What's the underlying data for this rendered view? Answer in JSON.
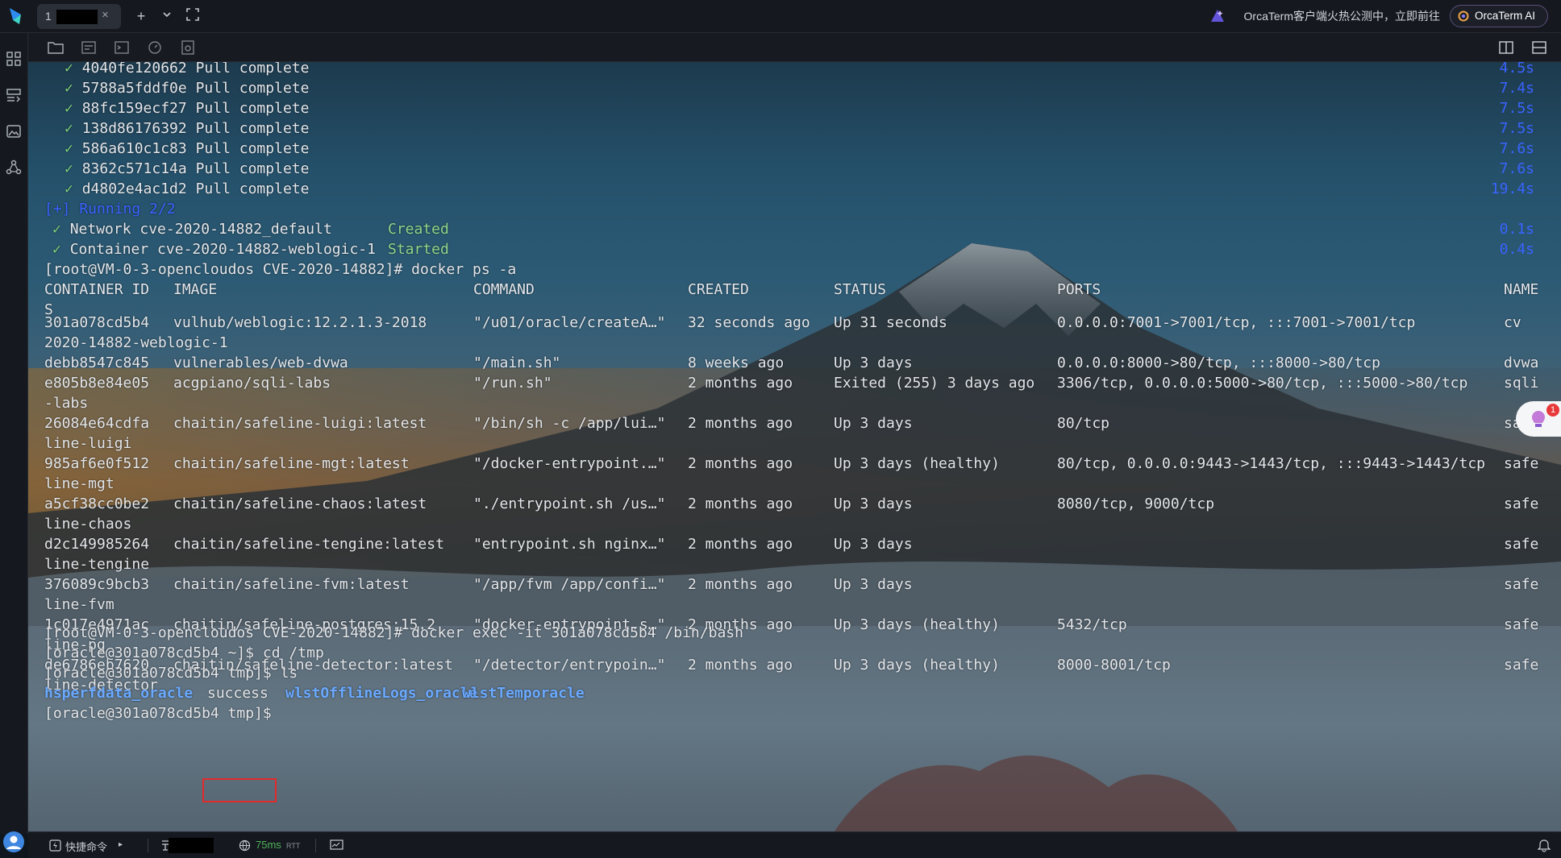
{
  "tabs": [
    {
      "label": "1",
      "close": "×"
    }
  ],
  "topbar": {
    "add": "+",
    "dropdown": "⌄",
    "fullscreen": "⛶",
    "promo": "OrcaTerm客户端火热公测中，立即前往",
    "ai_button": "OrcaTerm AI"
  },
  "terminal": {
    "pull_lines": [
      {
        "mark": "✓",
        "id": "4040fe120662",
        "status": "Pull complete",
        "time": "4.5s"
      },
      {
        "mark": "✓",
        "id": "5788a5fddf0e",
        "status": "Pull complete",
        "time": "7.4s"
      },
      {
        "mark": "✓",
        "id": "88fc159ecf27",
        "status": "Pull complete",
        "time": "7.5s"
      },
      {
        "mark": "✓",
        "id": "138d86176392",
        "status": "Pull complete",
        "time": "7.5s"
      },
      {
        "mark": "✓",
        "id": "586a610c1c83",
        "status": "Pull complete",
        "time": "7.6s"
      },
      {
        "mark": "✓",
        "id": "8362c571c14a",
        "status": "Pull complete",
        "time": "7.6s"
      },
      {
        "mark": "✓",
        "id": "d4802e4ac1d2",
        "status": "Pull complete",
        "time": "19.4s"
      }
    ],
    "running": "[+] Running 2/2",
    "network": {
      "mark": "✓",
      "text": "Network cve-2020-14882_default",
      "state": "Created",
      "time": "0.1s"
    },
    "container": {
      "mark": "✓",
      "text": "Container cve-2020-14882-weblogic-1",
      "state": "Started",
      "time": "0.4s"
    },
    "cmd_ps": "[root@VM-0-3-opencloudos CVE-2020-14882]# docker ps -a",
    "headers": {
      "id": "CONTAINER ID",
      "image": "IMAGE",
      "command": "COMMAND",
      "created": "CREATED",
      "status": "STATUS",
      "ports": "PORTS",
      "names": "NAME",
      "names_wrap": "S"
    },
    "rows": [
      {
        "id": "301a078cd5b4",
        "image": "vulhub/weblogic:12.2.1.3-2018",
        "command": "\"/u01/oracle/createA…\"",
        "created": "32 seconds ago",
        "status": "Up 31 seconds",
        "ports": "0.0.0.0:7001->7001/tcp, :::7001->7001/tcp",
        "names": "cv",
        "wrap": "2020-14882-weblogic-1"
      },
      {
        "id": "debb8547c845",
        "image": "vulnerables/web-dvwa",
        "command": "\"/main.sh\"",
        "created": "8 weeks ago",
        "status": "Up 3 days",
        "ports": "0.0.0.0:8000->80/tcp, :::8000->80/tcp",
        "names": "dvwa",
        "wrap": ""
      },
      {
        "id": "e805b8e84e05",
        "image": "acgpiano/sqli-labs",
        "command": "\"/run.sh\"",
        "created": "2 months ago",
        "status": "Exited (255) 3 days ago",
        "ports": "3306/tcp, 0.0.0.0:5000->80/tcp, :::5000->80/tcp",
        "names": "sqli",
        "wrap": "-labs"
      },
      {
        "id": "26084e64cdfa",
        "image": "chaitin/safeline-luigi:latest",
        "command": "\"/bin/sh -c /app/lui…\"",
        "created": "2 months ago",
        "status": "Up 3 days",
        "ports": "80/tcp",
        "names": "safe",
        "wrap": "line-luigi"
      },
      {
        "id": "985af6e0f512",
        "image": "chaitin/safeline-mgt:latest",
        "command": "\"/docker-entrypoint.…\"",
        "created": "2 months ago",
        "status": "Up 3 days (healthy)",
        "ports": "80/tcp, 0.0.0.0:9443->1443/tcp, :::9443->1443/tcp",
        "names": "safe",
        "wrap": "line-mgt"
      },
      {
        "id": "a5cf38cc0be2",
        "image": "chaitin/safeline-chaos:latest",
        "command": "\"./entrypoint.sh /us…\"",
        "created": "2 months ago",
        "status": "Up 3 days",
        "ports": "8080/tcp, 9000/tcp",
        "names": "safe",
        "wrap": "line-chaos"
      },
      {
        "id": "d2c149985264",
        "image": "chaitin/safeline-tengine:latest",
        "command": "\"entrypoint.sh nginx…\"",
        "created": "2 months ago",
        "status": "Up 3 days",
        "ports": "",
        "names": "safe",
        "wrap": "line-tengine"
      },
      {
        "id": "376089c9bcb3",
        "image": "chaitin/safeline-fvm:latest",
        "command": "\"/app/fvm /app/confi…\"",
        "created": "2 months ago",
        "status": "Up 3 days",
        "ports": "",
        "names": "safe",
        "wrap": "line-fvm"
      },
      {
        "id": "1c017e4971ac",
        "image": "chaitin/safeline-postgres:15.2",
        "command": "\"docker-entrypoint.s…\"",
        "created": "2 months ago",
        "status": "Up 3 days (healthy)",
        "ports": "5432/tcp",
        "names": "safe",
        "wrap": "line-pg"
      },
      {
        "id": "de6786eb7620",
        "image": "chaitin/safeline-detector:latest",
        "command": "\"/detector/entrypoin…\"",
        "created": "2 months ago",
        "status": "Up 3 days (healthy)",
        "ports": "8000-8001/tcp",
        "names": "safe",
        "wrap": "line-detector"
      }
    ],
    "cmd_exec": "[root@VM-0-3-opencloudos CVE-2020-14882]# docker exec -it 301a078cd5b4 /bin/bash",
    "cmd_cd": "[oracle@301a078cd5b4 ~]$ cd /tmp",
    "cmd_ls": "[oracle@301a078cd5b4 tmp]$ ls",
    "ls_entries": [
      "hsperfdata_oracle",
      "success",
      "wlstOfflineLogs_oracle",
      "wlstTemporacle"
    ],
    "prompt": "[oracle@301a078cd5b4 tmp]$",
    "notification_count": "1"
  },
  "statusbar": {
    "shortcuts": "快捷命令",
    "shortcuts_arrow": "▸",
    "latency": "75ms",
    "rtt": "RTT"
  },
  "colors": {
    "accent_blue": "#3a63ff",
    "ok_green": "#8fd68a",
    "dir_blue": "#6aa9ff",
    "highlight_red": "#e22a2a"
  }
}
